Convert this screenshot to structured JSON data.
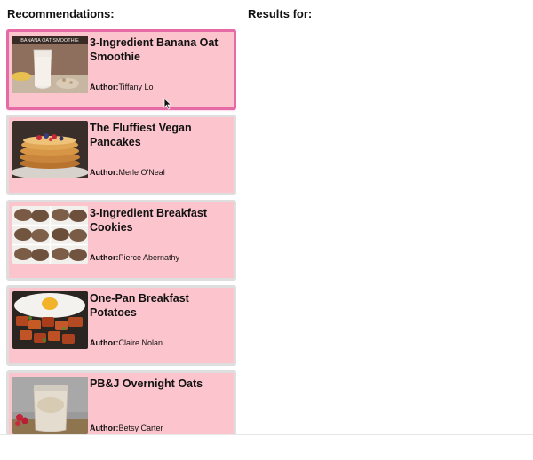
{
  "recommendations_heading": "Recommendations:",
  "results_heading": "Results for:",
  "recipes": [
    {
      "title": "3-Ingredient Banana Oat Smoothie",
      "author_label": "Author:",
      "author": "Tiffany Lo",
      "image_caption": "BANANA OAT SMOOTHIE",
      "selected": true
    },
    {
      "title": "The Fluffiest Vegan Pancakes",
      "author_label": "Author:",
      "author": "Merle O'Neal",
      "selected": false
    },
    {
      "title": "3-Ingredient Breakfast Cookies",
      "author_label": "Author:",
      "author": "Pierce Abernathy",
      "selected": false
    },
    {
      "title": "One-Pan Breakfast Potatoes",
      "author_label": "Author:",
      "author": "Claire Nolan",
      "selected": false
    },
    {
      "title": "PB&J Overnight Oats",
      "author_label": "Author:",
      "author": "Betsy Carter",
      "selected": false
    }
  ],
  "colors": {
    "card_bg": "#fcc4cc",
    "card_border": "#dedede",
    "selected_border": "#e66aa6"
  }
}
